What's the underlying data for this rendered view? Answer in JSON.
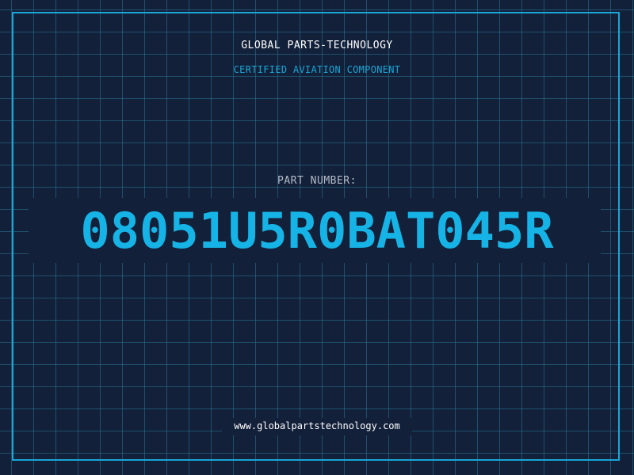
{
  "header": {
    "company_name": "GLOBAL PARTS-TECHNOLOGY",
    "subtitle": "CERTIFIED AVIATION COMPONENT"
  },
  "part": {
    "label": "PART NUMBER:",
    "number": "08051U5R0BAT045R"
  },
  "footer": {
    "website": "www.globalpartstechnology.com"
  },
  "colors": {
    "background": "#13203a",
    "grid": "#287896",
    "accent": "#16b4e6",
    "frame": "#1aa6d6",
    "text": "#ffffff",
    "muted_text": "#b5bcc8"
  }
}
